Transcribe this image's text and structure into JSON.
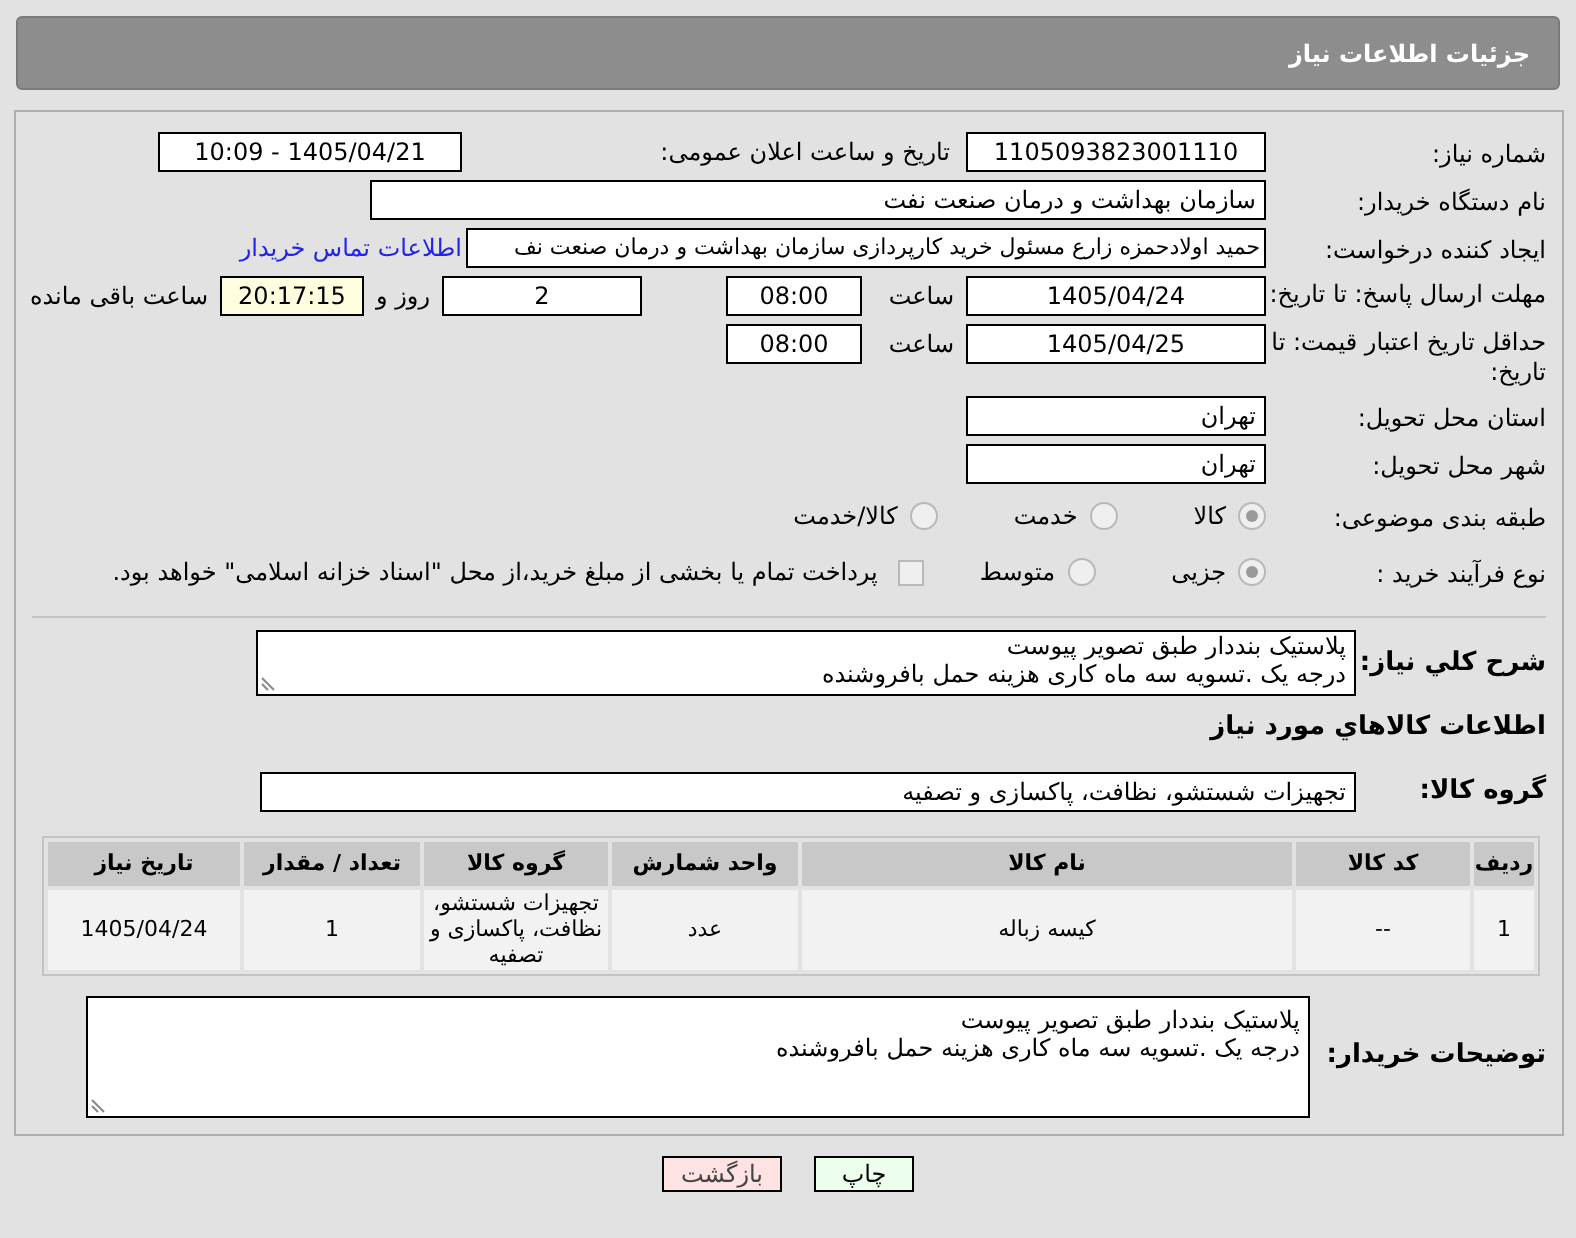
{
  "header": {
    "title": "جزئیات اطلاعات نیاز"
  },
  "need_number": {
    "label": "شماره نیاز:",
    "value": "1105093823001110"
  },
  "announce": {
    "label": "تاریخ و ساعت اعلان عمومی:",
    "value": "1405/04/21 - 10:09"
  },
  "buyer_org": {
    "label": "نام دستگاه خریدار:",
    "value": "سازمان بهداشت و درمان صنعت نفت"
  },
  "requester": {
    "label": "ایجاد کننده درخواست:",
    "value": "حمید اولادحمزه زارع مسئول خرید کارپردازی سازمان بهداشت و درمان صنعت نف",
    "link": "اطلاعات تماس خریدار"
  },
  "reply_deadline": {
    "label": "مهلت ارسال پاسخ: تا تاریخ:",
    "date": "1405/04/24",
    "time_label": "ساعت",
    "time": "08:00",
    "days": "2",
    "days_label": "روز و",
    "remaining": "20:17:15",
    "remaining_label": "ساعت باقی مانده"
  },
  "price_validity": {
    "label": "حداقل تاریخ اعتبار قیمت: تا تاریخ:",
    "date": "1405/04/25",
    "time_label": "ساعت",
    "time": "08:00"
  },
  "province": {
    "label": "استان محل تحویل:",
    "value": "تهران"
  },
  "city": {
    "label": "شهر محل تحویل:",
    "value": "تهران"
  },
  "category": {
    "label": "طبقه بندی موضوعی:",
    "options": [
      {
        "label": "کالا",
        "selected": true
      },
      {
        "label": "خدمت",
        "selected": false
      },
      {
        "label": "کالا/خدمت",
        "selected": false
      }
    ]
  },
  "process": {
    "label": "نوع فرآیند خرید :",
    "options": [
      {
        "label": "جزیی",
        "selected": true
      },
      {
        "label": "متوسط",
        "selected": false
      }
    ],
    "payment": {
      "checked": false,
      "label": "پرداخت تمام یا بخشی از مبلغ خرید،از محل \"اسناد خزانه اسلامی\" خواهد بود."
    }
  },
  "description": {
    "label": "شرح کلي نیاز:",
    "lines": [
      "پلاستیک بنددار طبق تصویر پیوست",
      "درجه یک .تسویه سه ماه کاری هزینه حمل بافروشنده"
    ]
  },
  "goods_title": "اطلاعات کالاهاي مورد نیاز",
  "goods_group": {
    "label": "گروه کالا:",
    "value": "تجهیزات شستشو، نظافت، پاکسازی و تصفیه"
  },
  "table": {
    "columns": [
      "ردیف",
      "کد کالا",
      "نام کالا",
      "واحد شمارش",
      "گروه کالا",
      "تعداد / مقدار",
      "تاریخ نیاز"
    ],
    "rows": [
      [
        "1",
        "--",
        "کیسه زباله",
        "عدد",
        "تجهیزات شستشو، نظافت، پاکسازی و تصفیه",
        "1",
        "1405/04/24"
      ]
    ]
  },
  "buyer_notes": {
    "label": "توضیحات خریدار:",
    "lines": [
      "پلاستیک بنددار طبق تصویر پیوست",
      "درجه یک .تسویه سه ماه کاری هزینه حمل بافروشنده"
    ]
  },
  "buttons": [
    {
      "label": "چاپ",
      "kind": "print"
    },
    {
      "label": "بازگشت",
      "kind": "back"
    }
  ]
}
